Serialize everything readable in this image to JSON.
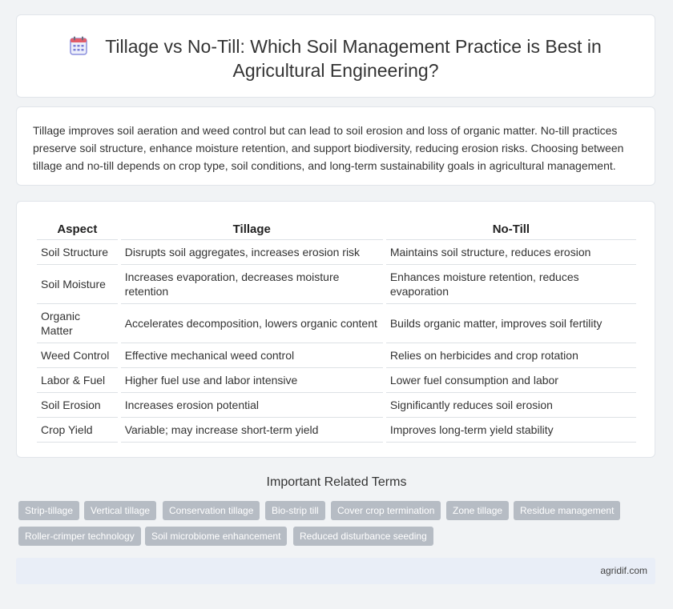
{
  "header": {
    "icon": "calendar-icon",
    "title_line1": "Tillage vs No-Till: Which Soil Management Practice is Best in",
    "title_line2": "Agricultural Engineering?"
  },
  "intro": "Tillage improves soil aeration and weed control but can lead to soil erosion and loss of organic matter. No-till practices preserve soil structure, enhance moisture retention, and support biodiversity, reducing erosion risks. Choosing between tillage and no-till depends on crop type, soil conditions, and long-term sustainability goals in agricultural management.",
  "table": {
    "headers": [
      "Aspect",
      "Tillage",
      "No-Till"
    ],
    "rows": [
      [
        "Soil Structure",
        "Disrupts soil aggregates, increases erosion risk",
        "Maintains soil structure, reduces erosion"
      ],
      [
        "Soil Moisture",
        "Increases evaporation, decreases moisture retention",
        "Enhances moisture retention, reduces evaporation"
      ],
      [
        "Organic Matter",
        "Accelerates decomposition, lowers organic content",
        "Builds organic matter, improves soil fertility"
      ],
      [
        "Weed Control",
        "Effective mechanical weed control",
        "Relies on herbicides and crop rotation"
      ],
      [
        "Labor & Fuel",
        "Higher fuel use and labor intensive",
        "Lower fuel consumption and labor"
      ],
      [
        "Soil Erosion",
        "Increases erosion potential",
        "Significantly reduces soil erosion"
      ],
      [
        "Crop Yield",
        "Variable; may increase short-term yield",
        "Improves long-term yield stability"
      ]
    ]
  },
  "related": {
    "title": "Important Related Terms",
    "tags": [
      "Strip-tillage",
      "Vertical tillage",
      "Conservation tillage",
      "Bio-strip till",
      "Cover crop termination",
      "Zone tillage",
      "Residue management",
      "Roller-crimper technology",
      "Soil microbiome enhancement",
      "Reduced disturbance seeding"
    ]
  },
  "footer": "agridif.com",
  "colors": {
    "tag_bg": "#b6bcc4",
    "icon_accent": "#7b7fd8",
    "icon_top": "#e35d6a"
  }
}
